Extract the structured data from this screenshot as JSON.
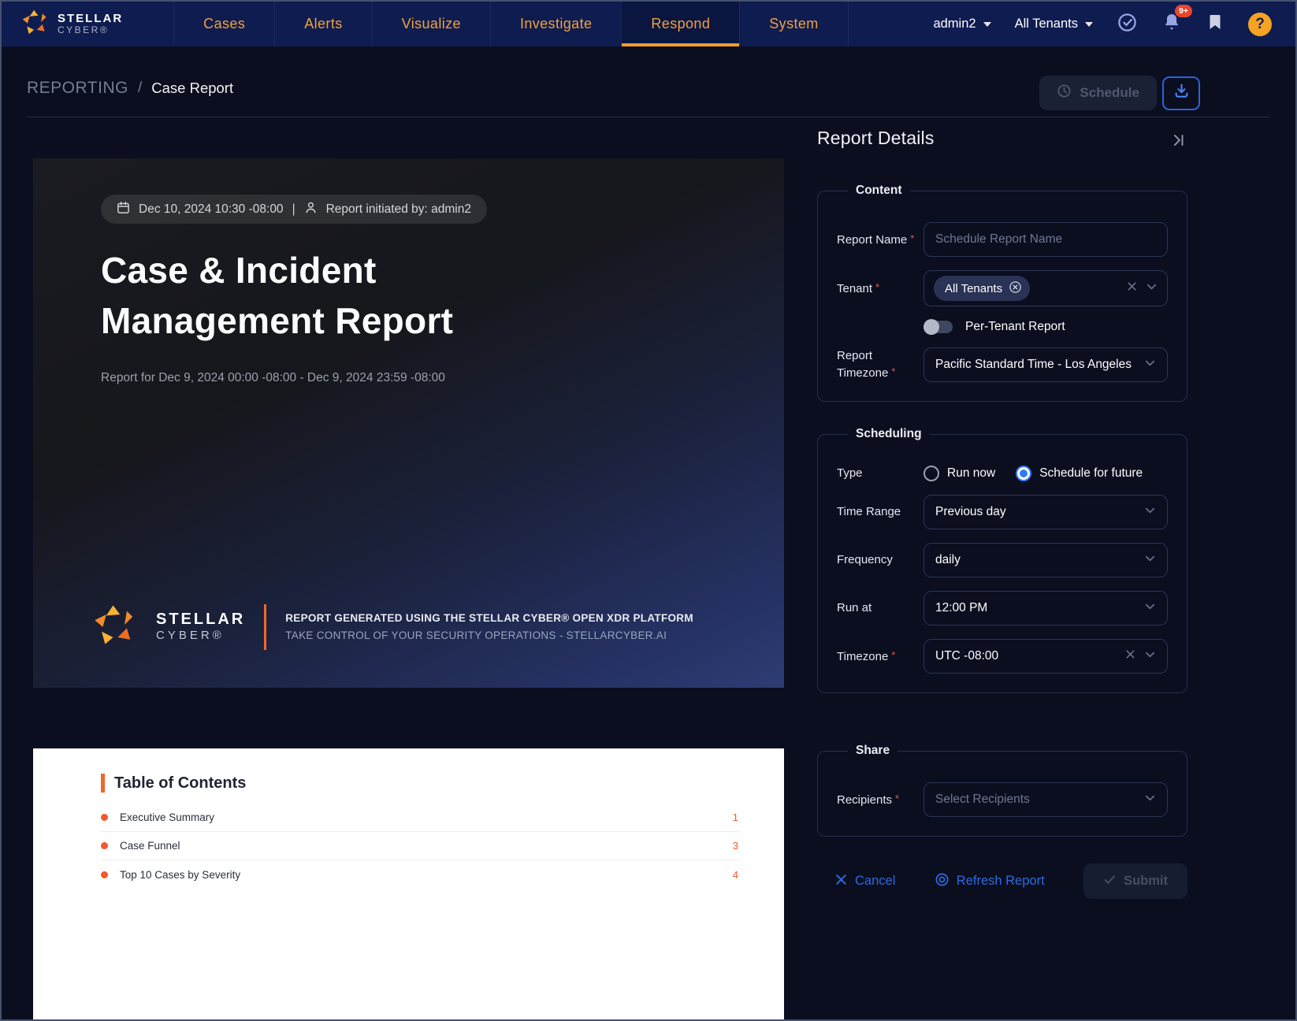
{
  "colors": {
    "nav_bg": "#0f1c50",
    "page_bg": "#0a0e1f",
    "accent_orange": "#f29b2d",
    "toc_orange": "#f05a2b",
    "action_blue": "#2e6bdf",
    "badge_red": "#e8452c"
  },
  "nav": {
    "brand_line1": "STELLAR",
    "brand_line2": "CYBER®",
    "items": [
      {
        "label": "Cases"
      },
      {
        "label": "Alerts"
      },
      {
        "label": "Visualize"
      },
      {
        "label": "Investigate"
      },
      {
        "label": "Respond"
      },
      {
        "label": "System"
      }
    ],
    "active_item": "Respond",
    "user_menu": "admin2",
    "tenant_menu": "All Tenants",
    "bell_badge": "9+",
    "help_glyph": "?"
  },
  "breadcrumb": {
    "section": "REPORTING",
    "separator": "/",
    "page": "Case Report"
  },
  "toolbar": {
    "schedule_label": "Schedule"
  },
  "cover": {
    "meta_datetime": "Dec 10, 2024 10:30 -08:00",
    "meta_separator": "|",
    "meta_initiated": "Report initiated by: admin2",
    "title_line1": "Case & Incident",
    "title_line2": "Management Report",
    "subtitle": "Report for Dec 9, 2024 00:00 -08:00 - Dec 9, 2024 23:59 -08:00",
    "brand_line1": "STELLAR",
    "brand_line2": "CYBER®",
    "footer_line1": "REPORT GENERATED USING THE STELLAR CYBER® OPEN XDR PLATFORM",
    "footer_line2": "TAKE CONTROL OF YOUR SECURITY OPERATIONS - STELLARCYBER.AI"
  },
  "toc": {
    "title": "Table of Contents",
    "items": [
      {
        "label": "Executive Summary",
        "page": "1"
      },
      {
        "label": "Case Funnel",
        "page": "3"
      },
      {
        "label": "Top 10 Cases by Severity",
        "page": "4"
      }
    ]
  },
  "panel": {
    "title": "Report Details",
    "content": {
      "legend": "Content",
      "report_name_label": "Report Name",
      "report_name_placeholder": "Schedule Report Name",
      "tenant_label": "Tenant",
      "tenant_chip": "All Tenants",
      "per_tenant_label": "Per-Tenant Report",
      "per_tenant_enabled": false,
      "report_timezone_label": "Report Timezone",
      "report_timezone_value": "Pacific Standard Time - Los Angeles"
    },
    "scheduling": {
      "legend": "Scheduling",
      "type_label": "Type",
      "type_options": [
        {
          "label": "Run now"
        },
        {
          "label": "Schedule for future"
        }
      ],
      "type_selected": "Schedule for future",
      "time_range_label": "Time Range",
      "time_range_value": "Previous day",
      "frequency_label": "Frequency",
      "frequency_value": "daily",
      "run_at_label": "Run at",
      "run_at_value": "12:00 PM",
      "timezone_label": "Timezone",
      "timezone_value": "UTC -08:00"
    },
    "share": {
      "legend": "Share",
      "recipients_label": "Recipients",
      "recipients_placeholder": "Select Recipients"
    },
    "actions": {
      "cancel_label": "Cancel",
      "refresh_label": "Refresh Report",
      "submit_label": "Submit"
    }
  }
}
